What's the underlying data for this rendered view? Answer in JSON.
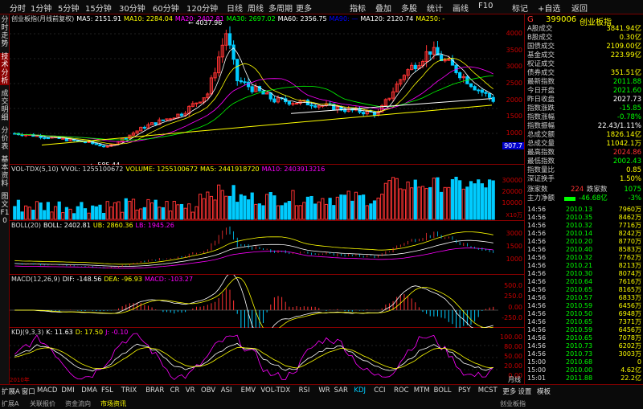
{
  "topbar": {
    "logo": "G",
    "items": [
      {
        "l": "分时"
      },
      {
        "l": "1分钟"
      },
      {
        "l": "5分钟"
      },
      {
        "l": "15分钟"
      },
      {
        "l": "30分钟"
      },
      {
        "l": "60分钟"
      },
      {
        "l": "120分钟"
      },
      {
        "l": "日线"
      },
      {
        "l": "周线"
      },
      {
        "l": "多周期"
      },
      {
        "l": "更多"
      }
    ],
    "right": [
      "指标",
      "叠加",
      "多股",
      "统计",
      "画线",
      "F10",
      "标记",
      "+自选",
      "返回"
    ]
  },
  "left_tabs": [
    "分时走势",
    "技术分析",
    "成交明细",
    "分价表",
    "基本资料",
    "图文F10"
  ],
  "main": {
    "title": "创业板指(月线前复权)",
    "ma": [
      {
        "t": "MA5: 2151.91",
        "c": "#fff"
      },
      {
        "t": "MA10: 2284.04",
        "c": "#ff0"
      },
      {
        "t": "MA20: 2402.81",
        "c": "#f0f"
      },
      {
        "t": "MA30: 2697.02",
        "c": "#0f0"
      },
      {
        "t": "MA60: 2356.75",
        "c": "#fff"
      },
      {
        "t": "MA90: —",
        "c": "#00f"
      },
      {
        "t": "MA120: 2120.74",
        "c": "#fff"
      },
      {
        "t": "MA250: -",
        "c": "#ff0"
      }
    ],
    "yticks": [
      "4000",
      "3500",
      "3000",
      "2500",
      "2000",
      "1500",
      "1000"
    ],
    "high_label": "4037.96",
    "low_label": "585.44",
    "last_tag": "907.7"
  },
  "vol": {
    "hdr": [
      {
        "t": "VOL-TDX(5,10)",
        "c": "#ddd"
      },
      {
        "t": "VVOL: 1255100672",
        "c": "#ddd"
      },
      {
        "t": "VOLUME: 1255100672",
        "c": "#ff0"
      },
      {
        "t": "MA5: 2441918720",
        "c": "#ff0"
      },
      {
        "t": "MA10: 2403913216",
        "c": "#f0f"
      }
    ],
    "yticks": [
      "30000",
      "20000",
      "10000"
    ],
    "unit": "X10万"
  },
  "boll": {
    "hdr": [
      {
        "t": "BOLL(20)",
        "c": "#ddd"
      },
      {
        "t": "BOLL: 2402.81",
        "c": "#fff"
      },
      {
        "t": "UB: 2860.36",
        "c": "#ff0"
      },
      {
        "t": "LB: 1945.26",
        "c": "#f0f"
      }
    ],
    "yticks": [
      "3000",
      "1500",
      "1000"
    ]
  },
  "macd": {
    "hdr": [
      {
        "t": "MACD(12,26,9)",
        "c": "#ddd"
      },
      {
        "t": "DIF: -148.56",
        "c": "#fff"
      },
      {
        "t": "DEA: -96.93",
        "c": "#ff0"
      },
      {
        "t": "MACD: -103.27",
        "c": "#f0f"
      }
    ],
    "yticks": [
      "500.0",
      "250.0",
      "0.00",
      "-250.0"
    ]
  },
  "kdj": {
    "hdr": [
      {
        "t": "KDJ(9,3,3)",
        "c": "#ddd"
      },
      {
        "t": "K: 11.63",
        "c": "#fff"
      },
      {
        "t": "D: 17.50",
        "c": "#ff0"
      },
      {
        "t": "J: -0.10",
        "c": "#f0f"
      }
    ],
    "yticks": [
      "100.00",
      "80.00",
      "50.00",
      "20.00",
      "0.00"
    ]
  },
  "xaxis": {
    "start": "2010年",
    "end_label": "月线"
  },
  "right": {
    "code": "399006",
    "name": "创业板指",
    "rows": [
      {
        "l": "A股成交",
        "v": "3841.94亿",
        "c": "#ff0"
      },
      {
        "l": "B股成交",
        "v": "0.30亿",
        "c": "#ff0"
      },
      {
        "l": "国债成交",
        "v": "2109.00亿",
        "c": "#ff0"
      },
      {
        "l": "基金成交",
        "v": "223.99亿",
        "c": "#ff0"
      },
      {
        "l": "权证成交",
        "v": "",
        "c": "#ff0"
      },
      {
        "l": "债券成交",
        "v": "351.51亿",
        "c": "#ff0"
      },
      {
        "l": "最新指数",
        "v": "2011.88",
        "c": "#0f0"
      },
      {
        "l": "今日开盘",
        "v": "2021.60",
        "c": "#0f0"
      },
      {
        "l": "昨日收盘",
        "v": "2027.73",
        "c": "#fff"
      },
      {
        "l": "指数涨跌",
        "v": "-15.85",
        "c": "#0f0"
      },
      {
        "l": "指数涨幅",
        "v": "-0.78%",
        "c": "#0f0"
      },
      {
        "l": "指数振幅",
        "v": "22.43/1.11%",
        "c": "#fff"
      },
      {
        "l": "总成交额",
        "v": "1826.14亿",
        "c": "#ff0"
      },
      {
        "l": "总成交量",
        "v": "11042.1万",
        "c": "#ff0"
      },
      {
        "l": "最高指数",
        "v": "2024.86",
        "c": "#f33"
      },
      {
        "l": "最低指数",
        "v": "2002.43",
        "c": "#0f0"
      },
      {
        "l": "指数量比",
        "v": "0.85",
        "c": "#ff0"
      },
      {
        "l": "深证换手",
        "v": "1.50%",
        "c": "#ff0"
      }
    ],
    "updown": {
      "l1": "涨家数",
      "v1": "224",
      "l2": "跌家数",
      "v2": "1075"
    },
    "netflow": {
      "l": "主力净额",
      "v": "-46.68亿",
      "p": "-3%"
    },
    "ticks": [
      {
        "t": "14:56",
        "p": "2010.13",
        "v": "7960万"
      },
      {
        "t": "14:56",
        "p": "2010.35",
        "v": "8462万"
      },
      {
        "t": "14:56",
        "p": "2010.32",
        "v": "7716万"
      },
      {
        "t": "14:56",
        "p": "2010.14",
        "v": "8242万"
      },
      {
        "t": "14:56",
        "p": "2010.20",
        "v": "8770万"
      },
      {
        "t": "14:56",
        "p": "2010.40",
        "v": "8583万"
      },
      {
        "t": "14:56",
        "p": "2010.32",
        "v": "7762万"
      },
      {
        "t": "14:56",
        "p": "2010.21",
        "v": "8213万"
      },
      {
        "t": "14:56",
        "p": "2010.30",
        "v": "8074万"
      },
      {
        "t": "14:56",
        "p": "2010.64",
        "v": "7616万"
      },
      {
        "t": "14:56",
        "p": "2010.65",
        "v": "8165万"
      },
      {
        "t": "14:56",
        "p": "2010.57",
        "v": "6833万"
      },
      {
        "t": "14:56",
        "p": "2010.59",
        "v": "6456万"
      },
      {
        "t": "14:56",
        "p": "2010.50",
        "v": "6948万"
      },
      {
        "t": "14:56",
        "p": "2010.65",
        "v": "7371万"
      },
      {
        "t": "14:56",
        "p": "2010.59",
        "v": "6456万"
      },
      {
        "t": "14:56",
        "p": "2010.65",
        "v": "7078万"
      },
      {
        "t": "14:56",
        "p": "2010.73",
        "v": "6202万"
      },
      {
        "t": "14:56",
        "p": "2010.73",
        "v": "3003万"
      },
      {
        "t": "15:00",
        "p": "2010.68",
        "v": "0"
      },
      {
        "t": "15:00",
        "p": "2010.00",
        "v": "4.62亿"
      },
      {
        "t": "15:01",
        "p": "2011.88",
        "v": "22.2亿"
      }
    ],
    "bottom_tabs": [
      "笔",
      "价",
      "细",
      "势",
      "联",
      "值",
      "主"
    ]
  },
  "bottom": {
    "tabs": [
      "扩展A",
      "窗口",
      "MACD",
      "DMI",
      "DMA",
      "FSL",
      "TRIX",
      "BRAR",
      "CR",
      "VR",
      "OBV",
      "ASI",
      "EMV",
      "VOL-TDX",
      "RSI",
      "WR",
      "SAR",
      "KDJ",
      "CCI",
      "ROC",
      "MTM",
      "BOLL",
      "PSY",
      "MCST",
      "更多",
      "设置"
    ],
    "active": "KDJ",
    "status": [
      "扩展A",
      "关联报价",
      "资金流向",
      "市场资讯"
    ],
    "right_status": "创业板指",
    "mode": "模板"
  },
  "colors": {
    "up": "#f33",
    "down": "#0cf",
    "ma5": "#fff",
    "ma10": "#ff0",
    "ma20": "#f0f",
    "ma30": "#0f0"
  },
  "chart_data": {
    "type": "candlestick",
    "title": "创业板指(月线前复权)",
    "high": 4037.96,
    "low": 585.44,
    "last": 2011.88,
    "ylim": [
      500,
      4200
    ]
  }
}
